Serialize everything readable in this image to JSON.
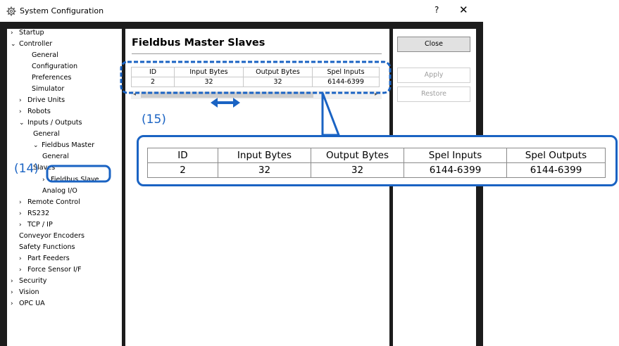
{
  "window": {
    "title": "System Configuration",
    "help": "?",
    "close": "✕"
  },
  "tree": [
    {
      "label": "Startup",
      "chev": "›"
    },
    {
      "label": "Controller",
      "chev": "⌄"
    },
    {
      "label": "General",
      "chev": ""
    },
    {
      "label": "Configuration",
      "chev": ""
    },
    {
      "label": "Preferences",
      "chev": ""
    },
    {
      "label": "Simulator",
      "chev": ""
    },
    {
      "label": "Drive Units",
      "chev": "›"
    },
    {
      "label": "Robots",
      "chev": "›"
    },
    {
      "label": "Inputs / Outputs",
      "chev": "⌄"
    },
    {
      "label": "General",
      "chev": ""
    },
    {
      "label": "Fieldbus Master",
      "chev": "⌄"
    },
    {
      "label": "General",
      "chev": ""
    },
    {
      "label": "Slaves",
      "chev": ""
    },
    {
      "label": "Fieldbus Slave",
      "chev": "›"
    },
    {
      "label": "Analog I/O",
      "chev": ""
    },
    {
      "label": "Remote Control",
      "chev": "›"
    },
    {
      "label": "RS232",
      "chev": "›"
    },
    {
      "label": "TCP / IP",
      "chev": "›"
    },
    {
      "label": "Conveyor Encoders",
      "chev": ""
    },
    {
      "label": "Safety Functions",
      "chev": ""
    },
    {
      "label": "Part Feeders",
      "chev": "›"
    },
    {
      "label": "Force Sensor I/F",
      "chev": "›"
    },
    {
      "label": "Security",
      "chev": "›"
    },
    {
      "label": "Vision",
      "chev": "›"
    },
    {
      "label": "OPC UA",
      "chev": "›"
    }
  ],
  "main": {
    "title": "Fieldbus Master Slaves",
    "columns": [
      "ID",
      "Input Bytes",
      "Output Bytes",
      "Spel Inputs"
    ],
    "row": [
      "2",
      "32",
      "32",
      "6144-6399"
    ],
    "scroll_left": "◂",
    "scroll_right": "▸"
  },
  "buttons": {
    "close": "Close",
    "apply": "Apply",
    "restore": "Restore"
  },
  "callouts": {
    "c14": "(14)",
    "c15": "(15)"
  },
  "zoom": {
    "columns": [
      "ID",
      "Input Bytes",
      "Output Bytes",
      "Spel Inputs",
      "Spel Outputs"
    ],
    "row": [
      "2",
      "32",
      "32",
      "6144-6399",
      "6144-6399"
    ]
  },
  "colors": {
    "callout_blue": "#1a63c3",
    "frame_dark": "#1c1c1c"
  }
}
